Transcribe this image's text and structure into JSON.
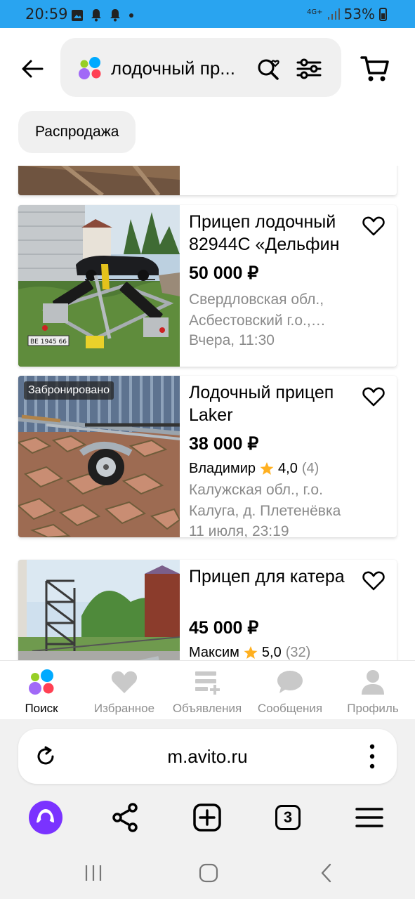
{
  "status_bar": {
    "time": "20:59",
    "network": "4G+",
    "battery": "53%"
  },
  "header": {
    "search_query": "лодочный пр...",
    "chip_label": "Распродажа"
  },
  "listings": [
    {
      "title": "Прицеп лодочный 82944С «Дельфин",
      "price": "50 000 ₽",
      "location": "Свердловская обл., Асбестовский г.о.,…",
      "date": "Вчера, 11:30",
      "plate": "ВЕ 1945 66"
    },
    {
      "title": "Лодочный прицеп Laker",
      "price": "38 000 ₽",
      "badge": "Забронировано",
      "seller": "Владимир",
      "rating": "4,0",
      "reviews": "(4)",
      "location": "Калужская обл., г.о. Калуга, д. Плетенёвка",
      "date": "11 июля, 23:19"
    },
    {
      "title": "Прицеп для катера",
      "price": "45 000 ₽",
      "seller": "Максим",
      "rating": "5,0",
      "reviews": "(32)"
    }
  ],
  "tabbar": [
    {
      "label": "Поиск",
      "icon": "avito-dots-icon",
      "active": true
    },
    {
      "label": "Избранное",
      "icon": "heart-icon"
    },
    {
      "label": "Объявления",
      "icon": "ads-icon"
    },
    {
      "label": "Сообщения",
      "icon": "chat-icon"
    },
    {
      "label": "Профиль",
      "icon": "profile-icon"
    }
  ],
  "browser": {
    "url": "m.avito.ru",
    "tabs_count": "3"
  },
  "colors": {
    "status_bar": "#29a4f0",
    "star": "#ffb020",
    "alice": "#7a33ff"
  }
}
